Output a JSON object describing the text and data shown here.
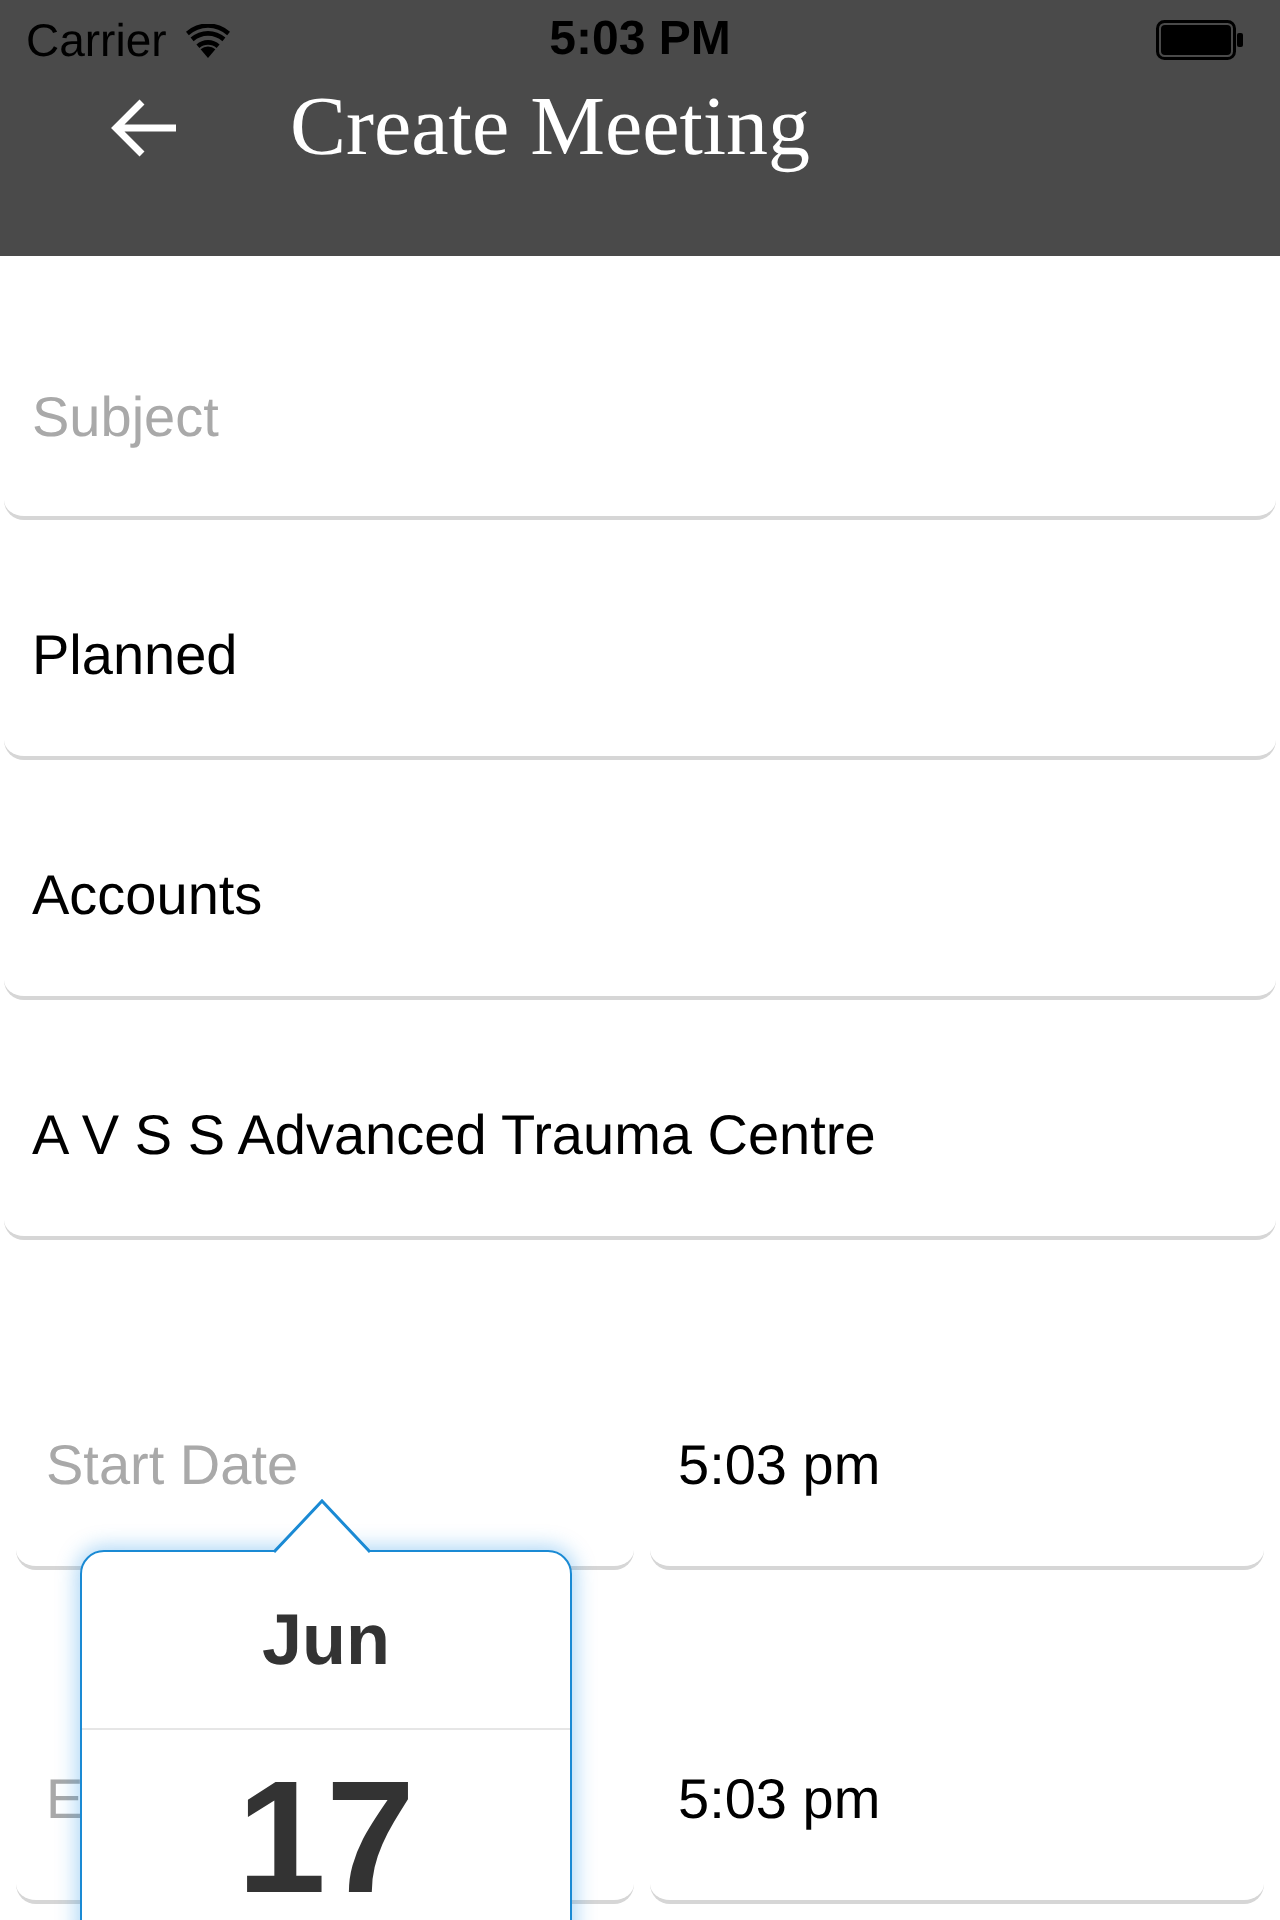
{
  "status_bar": {
    "carrier": "Carrier",
    "time": "5:03 PM"
  },
  "header": {
    "title": "Create Meeting"
  },
  "fields": [
    {
      "placeholder": "Subject"
    },
    {
      "value": "Planned"
    },
    {
      "value": "Accounts"
    },
    {
      "value": "A V S S Advanced Trauma Centre"
    }
  ],
  "schedule": [
    {
      "date": {
        "placeholder": "Start Date"
      },
      "time": {
        "value": "5:03 pm"
      }
    },
    {
      "date": {
        "placeholder": "E"
      },
      "time": {
        "value": "5:03 pm"
      }
    }
  ],
  "date_picker": {
    "month": "Jun",
    "day": "17"
  }
}
